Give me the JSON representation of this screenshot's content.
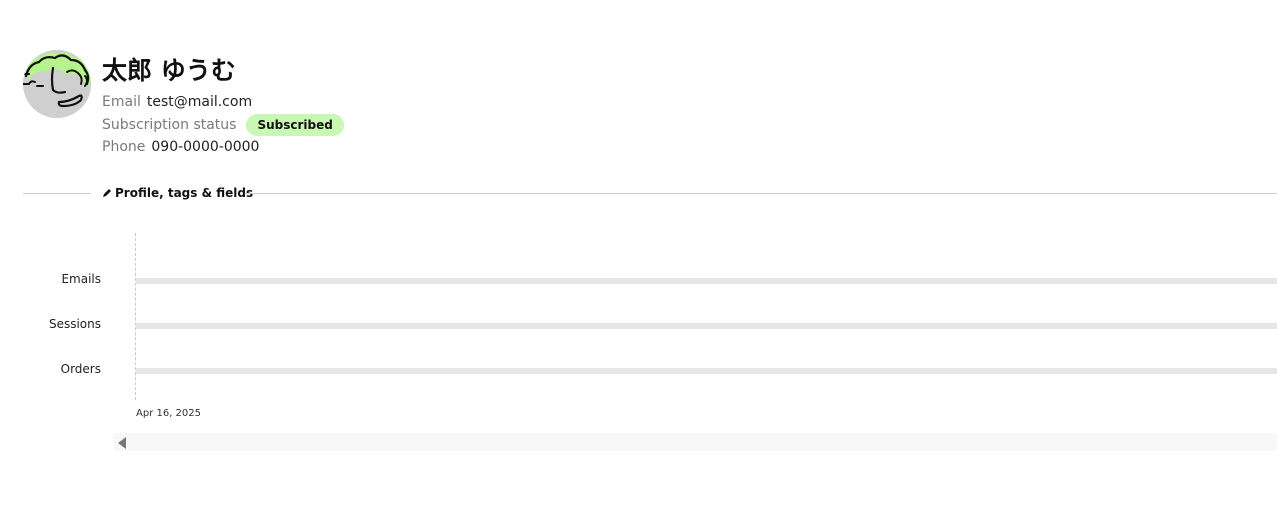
{
  "profile": {
    "name": "太郎 ゆうむ",
    "email_label": "Email",
    "email_value": "test@mail.com",
    "subscription_label": "Subscription status",
    "subscription_value": "Subscribed",
    "phone_label": "Phone",
    "phone_value": "090-0000-0000"
  },
  "section": {
    "edit_link_label": "Profile, tags & fields"
  },
  "timeline": {
    "tracks": [
      {
        "label": "Emails"
      },
      {
        "label": "Sessions"
      },
      {
        "label": "Orders"
      }
    ],
    "date_label": "Apr 16, 2025"
  },
  "colors": {
    "badge_background": "#c9f7b4",
    "avatar_hair": "#b6f28e",
    "avatar_face": "#cfcfcf",
    "track_bar": "#e6e6e6"
  },
  "icons": {
    "edit": "pencil-icon",
    "scroll": "caret-left-icon"
  }
}
